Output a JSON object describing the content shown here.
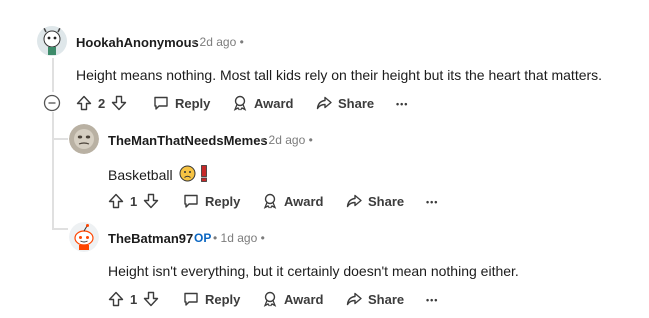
{
  "comments": [
    {
      "username": "HookahAnonymous",
      "meta": "• 2d ago •",
      "text": "Height means nothing. Most tall kids rely on their height but its the heart that matters.",
      "votes": "2",
      "reply_label": "Reply",
      "award_label": "Award",
      "share_label": "Share",
      "more_label": "•••"
    },
    {
      "username": "TheManThatNeedsMemes",
      "meta": "• 2d ago •",
      "text": "Basketball",
      "votes": "1",
      "reply_label": "Reply",
      "award_label": "Award",
      "share_label": "Share",
      "more_label": "•••"
    },
    {
      "username": "TheBatman97",
      "op_badge": "OP",
      "meta": "• 1d ago •",
      "text": "Height isn't everything, but it certainly doesn't mean nothing either.",
      "votes": "1",
      "reply_label": "Reply",
      "award_label": "Award",
      "share_label": "Share",
      "more_label": "•••"
    }
  ],
  "collapse_label": "−",
  "icons": [
    "collapse-icon",
    "upvote-icon",
    "downvote-icon",
    "reply-icon",
    "award-icon",
    "share-icon",
    "more-icon",
    "frowning-face-emoji",
    "exclamation-emoji"
  ]
}
